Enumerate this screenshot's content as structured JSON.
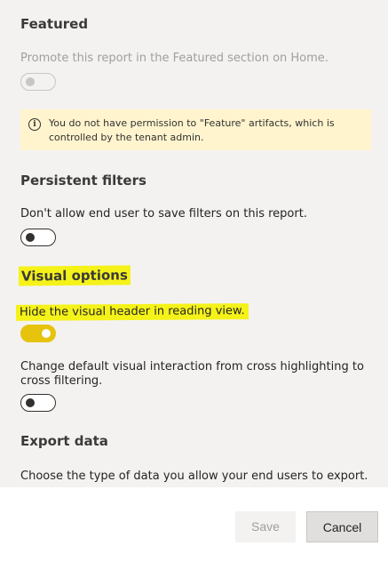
{
  "featured": {
    "heading": "Featured",
    "description": "Promote this report in the Featured section on Home.",
    "toggle_on": false,
    "toggle_disabled": true,
    "info_icon": "info-icon",
    "info_message": "You do not have permission to \"Feature\" artifacts, which is controlled by the tenant admin."
  },
  "persistent_filters": {
    "heading": "Persistent filters",
    "description": "Don't allow end user to save filters on this report.",
    "toggle_on": false
  },
  "visual_options": {
    "heading": "Visual options",
    "hide_header_description": "Hide the visual header in reading view.",
    "hide_header_toggle_on": true,
    "cross_filter_description": "Change default visual interaction from cross highlighting to cross filtering.",
    "cross_filter_toggle_on": false
  },
  "export_data": {
    "heading": "Export data",
    "description": "Choose the type of data you allow your end users to export."
  },
  "footer": {
    "save_label": "Save",
    "cancel_label": "Cancel"
  },
  "colors": {
    "highlight": "#f5f21a",
    "toggle_on": "#e6c30c",
    "info_bar": "#fff4ce",
    "panel_bg": "#f3f2f1"
  }
}
